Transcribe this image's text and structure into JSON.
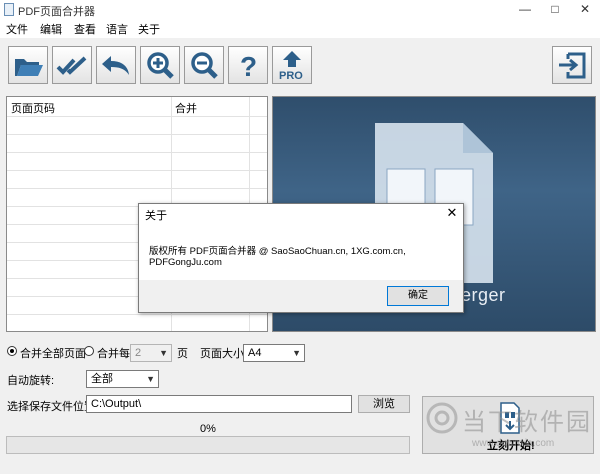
{
  "window": {
    "title": "PDF页面合并器"
  },
  "menu": [
    "文件",
    "编辑",
    "查看",
    "语言",
    "关于"
  ],
  "toolbar": {
    "buttons": [
      "open-folder-icon",
      "check-all-icon",
      "reply-all-icon",
      "zoom-in-icon",
      "zoom-out-icon",
      "help-icon",
      "pro-upgrade-icon"
    ],
    "pro_label": "PRO",
    "exit_icon": "exit-icon"
  },
  "page_list": {
    "columns": [
      "页面页码",
      "合并"
    ]
  },
  "preview": {
    "label_fragment": "erger"
  },
  "dialog": {
    "title": "关于",
    "message": "版权所有 PDF页面合并器 @ SaoSaoChuan.cn, 1XG.com.cn, PDFGongJu.com",
    "ok_label": "确定"
  },
  "options": {
    "merge_all_label": "合并全部页面",
    "merge_every_label": "合并每",
    "merge_every_value": "2",
    "page_unit": "页",
    "page_size_label": "页面大小:",
    "page_size_value": "A4",
    "auto_rotate_label": "自动旋转:",
    "auto_rotate_value": "全部",
    "save_location_label": "选择保存文件位置",
    "save_location_value": "C:\\Output\\",
    "browse_label": "浏览",
    "merge_all_selected": true
  },
  "progress": {
    "text": "0%",
    "value": 0
  },
  "start": {
    "label": "立刻开始!"
  },
  "watermark": {
    "text": "当下软件园",
    "url": "www.downxia.com"
  }
}
